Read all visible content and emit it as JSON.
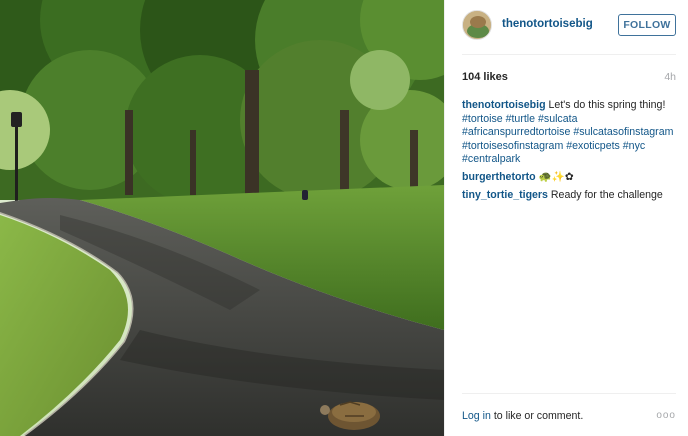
{
  "post": {
    "username": "thenotortoisebig",
    "follow_label": "FOLLOW",
    "likes": "104 likes",
    "time": "4h"
  },
  "caption": {
    "user": "thenotortoisebig",
    "text": "Let's do this spring thing!",
    "hashtags": [
      "#tortoise",
      "#turtle",
      "#sulcata",
      "#africanspurredtortoise",
      "#sulcatasofinstagram",
      "#tortoisesofinstagram",
      "#exoticpets",
      "#nyc",
      "#centralpark"
    ]
  },
  "comments": [
    {
      "user": "burgerthetorto",
      "text": "🐢✨✿"
    },
    {
      "user": "tiny_tortie_tigers",
      "text": "Ready for the challenge"
    }
  ],
  "footer": {
    "login_link": "Log in",
    "login_text": " to like or comment.",
    "more": "ooo"
  },
  "colors": {
    "link": "#125688",
    "follow": "#3f729b",
    "muted": "#a5a7aa"
  }
}
